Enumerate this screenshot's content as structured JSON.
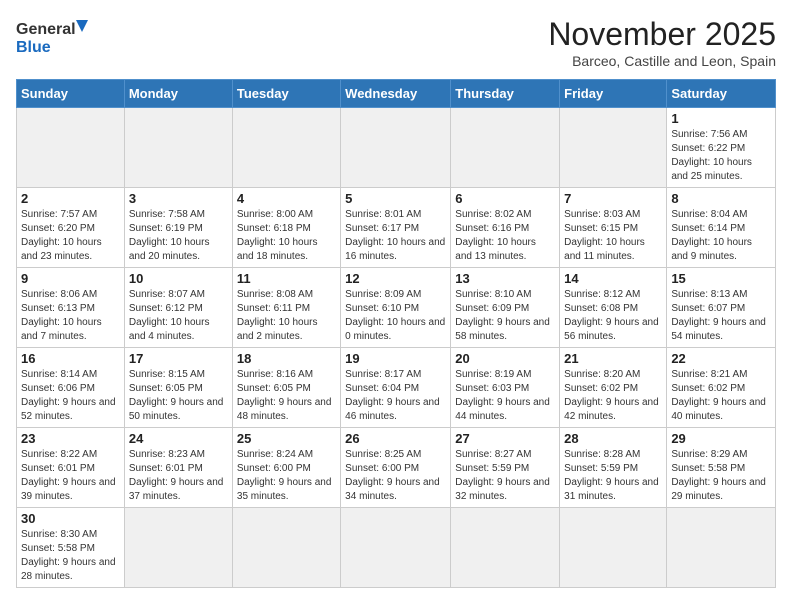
{
  "logo": {
    "line1": "General",
    "line2": "Blue"
  },
  "title": "November 2025",
  "location": "Barceo, Castille and Leon, Spain",
  "weekdays": [
    "Sunday",
    "Monday",
    "Tuesday",
    "Wednesday",
    "Thursday",
    "Friday",
    "Saturday"
  ],
  "weeks": [
    [
      {
        "day": "",
        "info": ""
      },
      {
        "day": "",
        "info": ""
      },
      {
        "day": "",
        "info": ""
      },
      {
        "day": "",
        "info": ""
      },
      {
        "day": "",
        "info": ""
      },
      {
        "day": "",
        "info": ""
      },
      {
        "day": "1",
        "info": "Sunrise: 7:56 AM\nSunset: 6:22 PM\nDaylight: 10 hours and 25 minutes."
      }
    ],
    [
      {
        "day": "2",
        "info": "Sunrise: 7:57 AM\nSunset: 6:20 PM\nDaylight: 10 hours and 23 minutes."
      },
      {
        "day": "3",
        "info": "Sunrise: 7:58 AM\nSunset: 6:19 PM\nDaylight: 10 hours and 20 minutes."
      },
      {
        "day": "4",
        "info": "Sunrise: 8:00 AM\nSunset: 6:18 PM\nDaylight: 10 hours and 18 minutes."
      },
      {
        "day": "5",
        "info": "Sunrise: 8:01 AM\nSunset: 6:17 PM\nDaylight: 10 hours and 16 minutes."
      },
      {
        "day": "6",
        "info": "Sunrise: 8:02 AM\nSunset: 6:16 PM\nDaylight: 10 hours and 13 minutes."
      },
      {
        "day": "7",
        "info": "Sunrise: 8:03 AM\nSunset: 6:15 PM\nDaylight: 10 hours and 11 minutes."
      },
      {
        "day": "8",
        "info": "Sunrise: 8:04 AM\nSunset: 6:14 PM\nDaylight: 10 hours and 9 minutes."
      }
    ],
    [
      {
        "day": "9",
        "info": "Sunrise: 8:06 AM\nSunset: 6:13 PM\nDaylight: 10 hours and 7 minutes."
      },
      {
        "day": "10",
        "info": "Sunrise: 8:07 AM\nSunset: 6:12 PM\nDaylight: 10 hours and 4 minutes."
      },
      {
        "day": "11",
        "info": "Sunrise: 8:08 AM\nSunset: 6:11 PM\nDaylight: 10 hours and 2 minutes."
      },
      {
        "day": "12",
        "info": "Sunrise: 8:09 AM\nSunset: 6:10 PM\nDaylight: 10 hours and 0 minutes."
      },
      {
        "day": "13",
        "info": "Sunrise: 8:10 AM\nSunset: 6:09 PM\nDaylight: 9 hours and 58 minutes."
      },
      {
        "day": "14",
        "info": "Sunrise: 8:12 AM\nSunset: 6:08 PM\nDaylight: 9 hours and 56 minutes."
      },
      {
        "day": "15",
        "info": "Sunrise: 8:13 AM\nSunset: 6:07 PM\nDaylight: 9 hours and 54 minutes."
      }
    ],
    [
      {
        "day": "16",
        "info": "Sunrise: 8:14 AM\nSunset: 6:06 PM\nDaylight: 9 hours and 52 minutes."
      },
      {
        "day": "17",
        "info": "Sunrise: 8:15 AM\nSunset: 6:05 PM\nDaylight: 9 hours and 50 minutes."
      },
      {
        "day": "18",
        "info": "Sunrise: 8:16 AM\nSunset: 6:05 PM\nDaylight: 9 hours and 48 minutes."
      },
      {
        "day": "19",
        "info": "Sunrise: 8:17 AM\nSunset: 6:04 PM\nDaylight: 9 hours and 46 minutes."
      },
      {
        "day": "20",
        "info": "Sunrise: 8:19 AM\nSunset: 6:03 PM\nDaylight: 9 hours and 44 minutes."
      },
      {
        "day": "21",
        "info": "Sunrise: 8:20 AM\nSunset: 6:02 PM\nDaylight: 9 hours and 42 minutes."
      },
      {
        "day": "22",
        "info": "Sunrise: 8:21 AM\nSunset: 6:02 PM\nDaylight: 9 hours and 40 minutes."
      }
    ],
    [
      {
        "day": "23",
        "info": "Sunrise: 8:22 AM\nSunset: 6:01 PM\nDaylight: 9 hours and 39 minutes."
      },
      {
        "day": "24",
        "info": "Sunrise: 8:23 AM\nSunset: 6:01 PM\nDaylight: 9 hours and 37 minutes."
      },
      {
        "day": "25",
        "info": "Sunrise: 8:24 AM\nSunset: 6:00 PM\nDaylight: 9 hours and 35 minutes."
      },
      {
        "day": "26",
        "info": "Sunrise: 8:25 AM\nSunset: 6:00 PM\nDaylight: 9 hours and 34 minutes."
      },
      {
        "day": "27",
        "info": "Sunrise: 8:27 AM\nSunset: 5:59 PM\nDaylight: 9 hours and 32 minutes."
      },
      {
        "day": "28",
        "info": "Sunrise: 8:28 AM\nSunset: 5:59 PM\nDaylight: 9 hours and 31 minutes."
      },
      {
        "day": "29",
        "info": "Sunrise: 8:29 AM\nSunset: 5:58 PM\nDaylight: 9 hours and 29 minutes."
      }
    ],
    [
      {
        "day": "30",
        "info": "Sunrise: 8:30 AM\nSunset: 5:58 PM\nDaylight: 9 hours and 28 minutes."
      },
      {
        "day": "",
        "info": ""
      },
      {
        "day": "",
        "info": ""
      },
      {
        "day": "",
        "info": ""
      },
      {
        "day": "",
        "info": ""
      },
      {
        "day": "",
        "info": ""
      },
      {
        "day": "",
        "info": ""
      }
    ]
  ]
}
